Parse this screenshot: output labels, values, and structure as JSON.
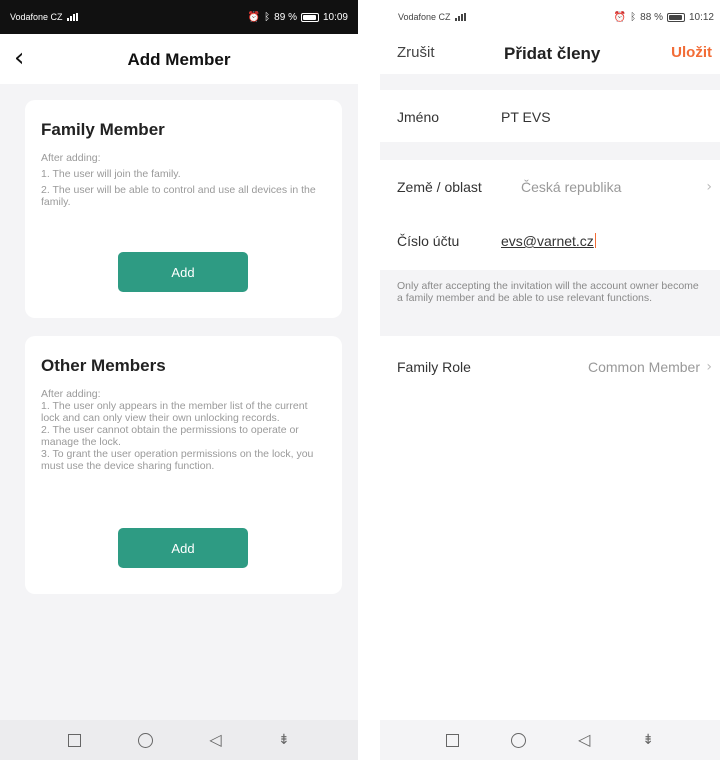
{
  "left": {
    "status": {
      "carrier": "Vodafone CZ",
      "battery": "89 %",
      "time": "10:09"
    },
    "header": {
      "title": "Add Member"
    },
    "family_card": {
      "title": "Family Member",
      "lines": [
        "After adding:",
        "1. The user will join the family.",
        "2. The user will be able to control and use all devices in the family."
      ],
      "button": "Add"
    },
    "other_card": {
      "title": "Other Members",
      "lines": [
        "After adding:",
        "1. The user only appears in the member list of the current lock and can only view their own unlocking records.",
        "2. The user cannot obtain the permissions to operate or manage the lock.",
        "3. To grant the user operation permissions on the lock, you must use the device sharing function."
      ],
      "button": "Add"
    }
  },
  "right": {
    "status": {
      "carrier": "Vodafone CZ",
      "battery": "88 %",
      "time": "10:12"
    },
    "header": {
      "cancel": "Zrušit",
      "title": "Přidat členy",
      "save": "Uložit"
    },
    "name": {
      "label": "Jméno",
      "value": "PT EVS"
    },
    "region": {
      "label": "Země / oblast",
      "value": "Česká republika"
    },
    "account": {
      "label": "Číslo účtu",
      "value": "evs@varnet.cz"
    },
    "note": "Only after accepting the invitation will the account owner become a family member and be able to use relevant functions.",
    "role": {
      "label": "Family Role",
      "value": "Common Member"
    }
  },
  "icons": {
    "back": "chevron-left-icon",
    "chevron": "chevron-right-icon",
    "nav": [
      "square-icon",
      "circle-icon",
      "triangle-back-icon",
      "pull-down-icon"
    ]
  },
  "colors": {
    "accent_green": "#2e9b83",
    "accent_orange": "#f26c36",
    "background": "#f4f4f6"
  }
}
